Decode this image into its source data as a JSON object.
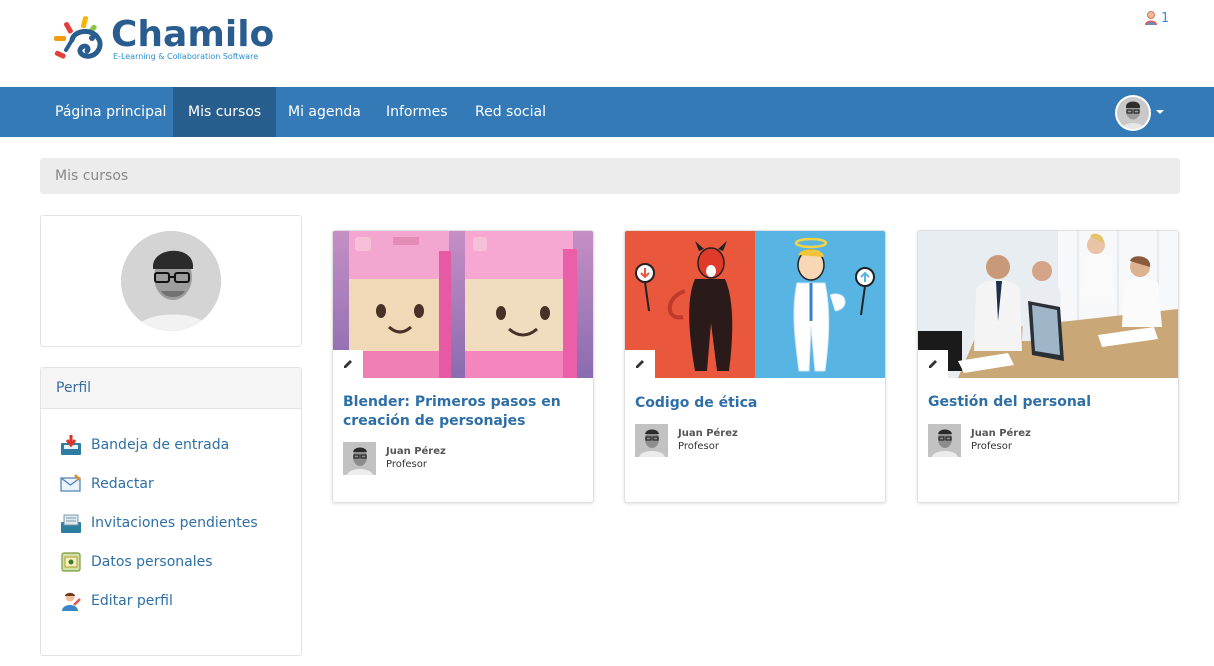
{
  "header": {
    "logo_text": "Chamilo",
    "logo_subtitle": "E-Learning & Collaboration Software",
    "notification_count": "1"
  },
  "nav": {
    "items": [
      {
        "label": "Página principal",
        "active": false
      },
      {
        "label": "Mis cursos",
        "active": true
      },
      {
        "label": "Mi agenda",
        "active": false
      },
      {
        "label": "Informes",
        "active": false
      },
      {
        "label": "Red social",
        "active": false
      }
    ]
  },
  "breadcrumb": {
    "current": "Mis cursos"
  },
  "sidebar": {
    "panel_title": "Perfil",
    "items": [
      {
        "label": "Bandeja de entrada",
        "icon": "inbox-icon"
      },
      {
        "label": "Redactar",
        "icon": "compose-icon"
      },
      {
        "label": "Invitaciones pendientes",
        "icon": "invitations-icon"
      },
      {
        "label": "Datos personales",
        "icon": "personal-data-icon"
      },
      {
        "label": "Editar perfil",
        "icon": "edit-profile-icon"
      }
    ]
  },
  "courses": [
    {
      "title": "Blender: Primeros pasos en creación de personajes",
      "teacher": "Juan Pérez",
      "role": "Profesor"
    },
    {
      "title": "Codigo de ética",
      "teacher": "Juan Pérez",
      "role": "Profesor"
    },
    {
      "title": "Gestión del personal",
      "teacher": "Juan Pérez",
      "role": "Profesor"
    }
  ],
  "colors": {
    "navbar": "#337ab7",
    "navbar_active": "#285e8e",
    "link": "#2f6fa7"
  }
}
